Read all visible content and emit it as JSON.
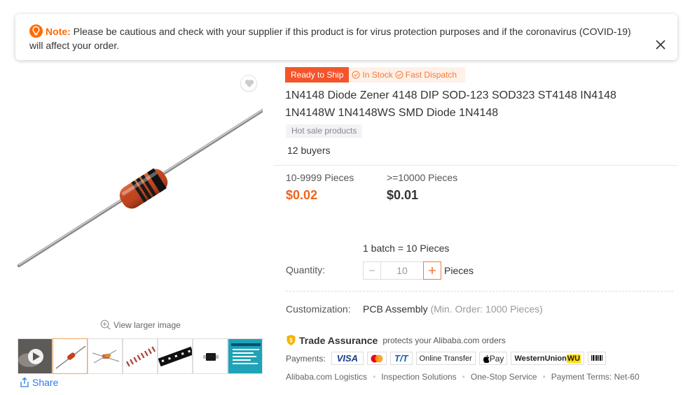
{
  "note": {
    "label": "Note:",
    "text": " Please be cautious and check with your supplier if this product is for virus protection purposes and if the coronavirus (COVID-19) will affect your order."
  },
  "gallery": {
    "view_larger": "View larger image",
    "share": "Share",
    "thumbnails": [
      "video",
      "diode-axial",
      "diode-components",
      "diode-tape-reel",
      "smd-tape",
      "smd-chip",
      "product-info-card"
    ]
  },
  "badges": {
    "ready": "Ready to Ship",
    "stock": "In Stock",
    "dispatch": "Fast Dispatch"
  },
  "product": {
    "title": "1N4148 Diode Zener 4148 DIP SOD-123 SOD323 ST4148 IN4148 1N4148W 1N4148WS SMD Diode 1N4148",
    "tag": "Hot sale products",
    "buyers": "12 buyers"
  },
  "pricing": {
    "tiers": [
      {
        "range": "10-9999 Pieces",
        "price": "$0.02"
      },
      {
        "range": ">=10000 Pieces",
        "price": "$0.01"
      }
    ]
  },
  "order": {
    "batch": "1 batch = 10 Pieces",
    "quantity_label": "Quantity:",
    "quantity_value": "10",
    "unit": "Pieces"
  },
  "customization": {
    "label": "Customization:",
    "value": "PCB Assembly",
    "min_order": "(Min. Order: 1000 Pieces)"
  },
  "trade_assurance": {
    "name": "Trade Assurance",
    "desc": "protects your Alibaba.com orders"
  },
  "payments": {
    "label": "Payments:",
    "methods": [
      "VISA",
      "T/T",
      "Online Transfer",
      "Pay",
      "WesternUnion",
      "WU",
      "Boleto"
    ]
  },
  "services": [
    "Alibaba.com Logistics",
    "Inspection Solutions",
    "One-Stop Service",
    "Payment Terms: Net-60"
  ],
  "colors": {
    "accent": "#ff6a00",
    "price": "#f0631e",
    "ready_badge": "#f4542a",
    "link": "#2c7be5"
  }
}
